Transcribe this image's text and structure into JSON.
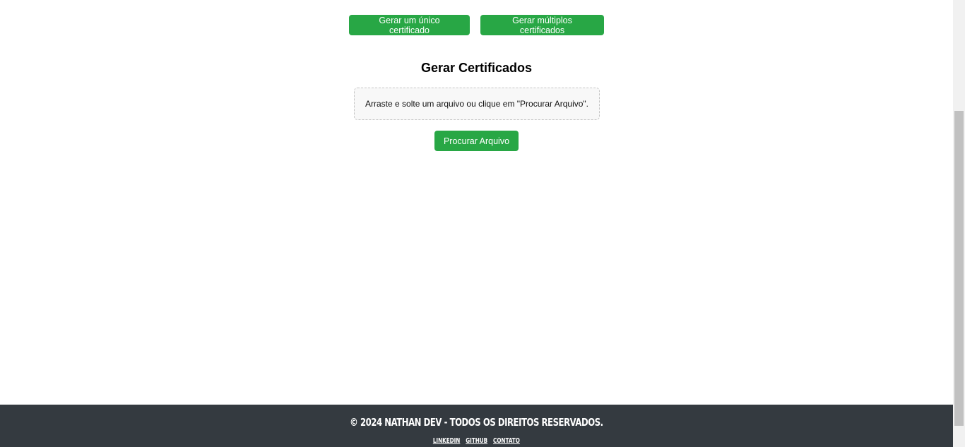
{
  "modes": {
    "single_label": "Gerar um único certificado",
    "multiple_label": "Gerar múltiplos certificados"
  },
  "main": {
    "title": "Gerar Certificados",
    "dropzone_text": "Arraste e solte um arquivo ou clique em \"Procurar Arquivo\".",
    "browse_label": "Procurar Arquivo"
  },
  "footer": {
    "copyright": "© 2024 Nathan Dev - Todos os direitos reservados.",
    "links": {
      "linkedin": "LinkedIn",
      "github": "GitHub",
      "contact": "Contato"
    }
  },
  "colors": {
    "accent": "#28a745",
    "footer_bg": "#343a40"
  }
}
